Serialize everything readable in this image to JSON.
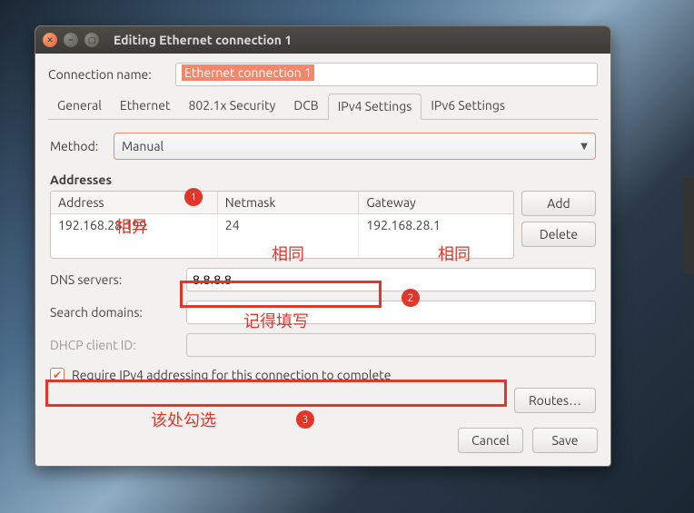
{
  "titlebar": {
    "title": "Editing Ethernet connection 1"
  },
  "connection": {
    "name_label": "Connection name:",
    "name_value": "Ethernet connection 1"
  },
  "tabs": {
    "items": [
      {
        "label": "General"
      },
      {
        "label": "Ethernet"
      },
      {
        "label": "802.1x Security"
      },
      {
        "label": "DCB"
      },
      {
        "label": "IPv4 Settings"
      },
      {
        "label": "IPv6 Settings"
      }
    ],
    "active_index": 4
  },
  "ipv4": {
    "method_label": "Method:",
    "method_value": "Manual",
    "addresses_title": "Addresses",
    "columns": {
      "address": "Address",
      "netmask": "Netmask",
      "gateway": "Gateway"
    },
    "rows": [
      {
        "address": "192.168.28.199",
        "netmask": "24",
        "gateway": "192.168.28.1"
      }
    ],
    "add_label": "Add",
    "delete_label": "Delete",
    "dns_label": "DNS servers:",
    "dns_value": "8.8.8.8",
    "search_label": "Search domains:",
    "search_value": "",
    "dhcp_label": "DHCP client ID:",
    "dhcp_value": "",
    "require_label": "Require IPv4 addressing for this connection to complete",
    "require_checked": true,
    "routes_label": "Routes…"
  },
  "footer": {
    "cancel": "Cancel",
    "save": "Save"
  },
  "annotations": {
    "b1": "1",
    "b2": "2",
    "b3": "3",
    "t_diff": "相异",
    "t_same1": "相同",
    "t_same2": "相同",
    "t_fill": "记得填写",
    "t_check": "该处勾选"
  }
}
